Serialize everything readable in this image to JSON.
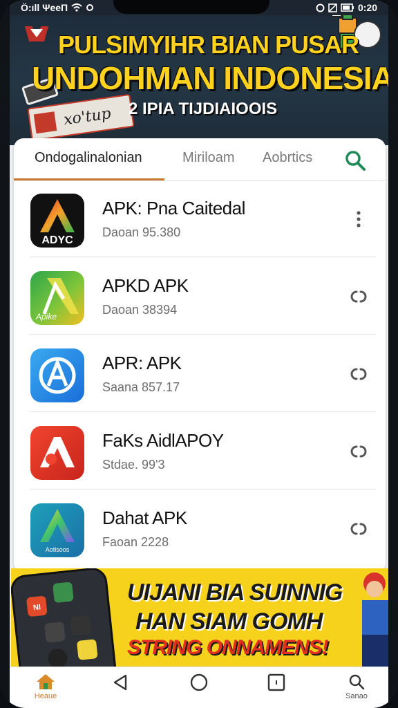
{
  "status_bar": {
    "left_text": "Ö:ıll ΨeeΠ",
    "time": "0:20"
  },
  "banner": {
    "title_line1": "PULSIMYIHR BIAN PUSAR",
    "title_line2": "UNDOHMAN INDONESIA",
    "subtitle": "2 IPIA TIJDIAIOOIS",
    "ticket_text": "xo'tup"
  },
  "tabs": [
    {
      "label": "Ondogalinalonian",
      "active": true
    },
    {
      "label": "Miriloam",
      "active": false
    },
    {
      "label": "Aobrtics",
      "active": false
    }
  ],
  "apps": [
    {
      "name": "APK: Pna Caitedal",
      "meta": "Daoan 95.380",
      "icon_label": "ADYC",
      "action_icon": "more-vert-icon"
    },
    {
      "name": "APKD APK",
      "meta": "Daoan 38394",
      "icon_label": "Apike",
      "action_icon": "link-icon"
    },
    {
      "name": "APR: APK",
      "meta": "Saana 857.17",
      "icon_label": "",
      "action_icon": "link-icon"
    },
    {
      "name": "FaKs AidlAPOY",
      "meta": "Stdae. 99'3",
      "icon_label": "",
      "action_icon": "link-icon"
    },
    {
      "name": "Dahat APK",
      "meta": "Faoan 2228",
      "icon_label": "Aotlsoos",
      "action_icon": "link-icon"
    }
  ],
  "ad": {
    "line1": "UIJANI BIA SUINNIG",
    "line2": "HAN SIAM GOMH",
    "line3": "STRING ONNAMENS!",
    "phone_tile_text": "NI"
  },
  "nav": [
    {
      "label": "Heaue",
      "icon": "home-icon",
      "active": true
    },
    {
      "label": "",
      "icon": "back-icon",
      "active": false
    },
    {
      "label": "",
      "icon": "circle-home-icon",
      "active": false
    },
    {
      "label": "",
      "icon": "square-recents-icon",
      "active": false
    },
    {
      "label": "Sanao",
      "icon": "search-icon",
      "active": false
    }
  ],
  "colors": {
    "accent": "#c9772b",
    "search_green": "#1f8a55",
    "banner_yellow": "#ffd21f",
    "ad_yellow": "#f6d21c"
  }
}
